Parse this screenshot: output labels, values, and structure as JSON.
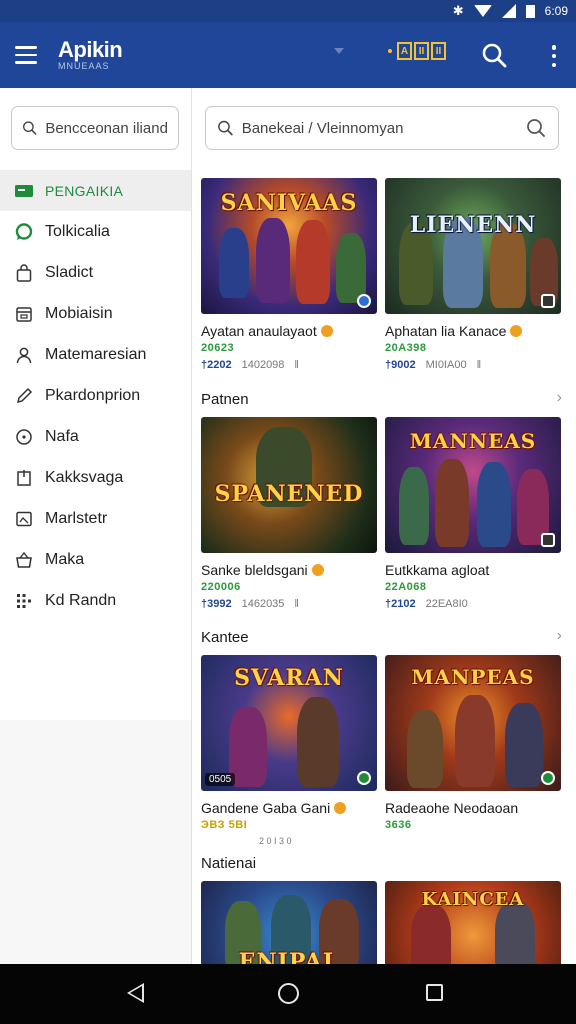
{
  "app": {
    "brand_title": "Apikin",
    "brand_sub": "MNUEAAS",
    "badge_letters": [
      "A",
      "II",
      "II"
    ]
  },
  "colors": {
    "appbar": "#1f4699",
    "statusbar": "#1c3f86",
    "active": "#1e8c3a",
    "download": "#1f4699"
  },
  "status": {
    "clock": "6:09"
  },
  "sidebar": {
    "search_placeholder": "Bencceonan iliand",
    "items": [
      {
        "label": "PENGAIKIA",
        "icon": "card-icon",
        "active": true
      },
      {
        "label": "Tolkicalia",
        "icon": "chat-bubble-icon",
        "active": false
      },
      {
        "label": "Sladict",
        "icon": "bag-icon",
        "active": false
      },
      {
        "label": "Mobiaisin",
        "icon": "calendar-icon",
        "active": false
      },
      {
        "label": "Matemaresian",
        "icon": "person-icon",
        "active": false
      },
      {
        "label": "Pkardonprion",
        "icon": "pencil-icon",
        "active": false
      },
      {
        "label": "Nafa",
        "icon": "circle-icon",
        "active": false
      },
      {
        "label": "Kakksvaga",
        "icon": "door-icon",
        "active": false
      },
      {
        "label": "Marlstetr",
        "icon": "image-icon",
        "active": false
      },
      {
        "label": "Maka",
        "icon": "basket-icon",
        "active": false
      },
      {
        "label": "Kd Randn",
        "icon": "grid-icon",
        "active": false
      }
    ]
  },
  "main": {
    "search_placeholder": "Banekeai / Vleinnomyan",
    "rows": [
      {
        "title": "",
        "cards": [
          {
            "art": "SANIVAAS",
            "title": "Ayatan anaulayaot",
            "rating": "20623",
            "downloads": "†2202",
            "size": "1402098",
            "extra": "ǁ",
            "badge": "blue"
          },
          {
            "art": "LIENENN",
            "title": "Aphatan lia Kanace",
            "rating": "20A398",
            "downloads": "†9002",
            "size": "MI0IA00",
            "extra": "ǁ",
            "badge": "dark"
          }
        ]
      },
      {
        "title": "Patnen",
        "cards": [
          {
            "art": "SPANENED",
            "title": "Sanke bleldsgani",
            "rating": "220006",
            "downloads": "†3992",
            "size": "1462035",
            "extra": "ǁ",
            "badge": "none"
          },
          {
            "art": "MANNEAS",
            "title": "Eutkkama agloat",
            "rating": "22A068",
            "downloads": "†2102",
            "size": "22EA8I0",
            "extra": "",
            "badge": "dark"
          }
        ]
      },
      {
        "title": "Kantee",
        "cards": [
          {
            "art": "SVARAN",
            "title": "Gandene Gaba Gani",
            "rating": "ЭВЗ 5ВI",
            "downloads": "",
            "size": "2 0 I 3 0",
            "extra": "",
            "badge": "green",
            "tag": "0505"
          },
          {
            "art": "MANPEAS",
            "title": "Radeaohe Neodaoan",
            "rating": "3636",
            "downloads": "",
            "size": "",
            "extra": "",
            "badge": "green"
          }
        ]
      },
      {
        "title": "Natienai",
        "cards": [
          {
            "art": "ENIPAL",
            "title": "",
            "rating": "",
            "downloads": "",
            "size": "",
            "extra": "",
            "badge": "none"
          },
          {
            "art": "KAINCEA",
            "title": "",
            "rating": "",
            "downloads": "",
            "size": "",
            "extra": "",
            "badge": "none"
          }
        ]
      }
    ]
  }
}
